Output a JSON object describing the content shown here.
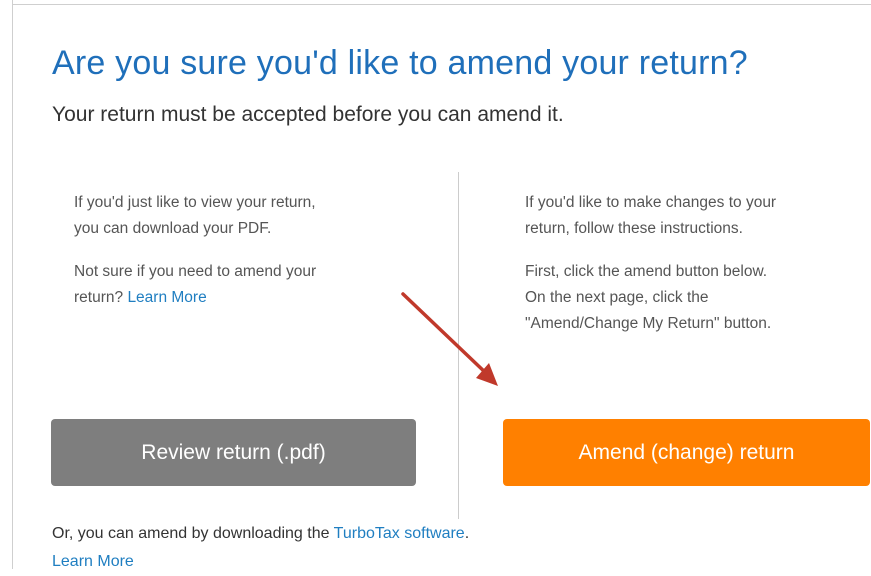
{
  "dialog": {
    "title": "Are you sure you'd like to amend your return?",
    "subtitle": "Your return must be accepted before you can amend it."
  },
  "left_column": {
    "para1_line1": "If you'd just like to view your return,",
    "para1_line2": "you can download your PDF.",
    "para2_line1": "Not sure if you need to amend your",
    "para2_line2_prefix": "return?",
    "learn_more_link": "Learn More"
  },
  "right_column": {
    "para1_line1": "If you'd like to make changes to your",
    "para1_line2": "return, follow these instructions.",
    "para2_line1": "First, click the amend button below.",
    "para2_line2": "On the next page, click the",
    "para2_line3": "\"Amend/Change My Return\" button."
  },
  "buttons": {
    "review_label": "Review return (.pdf)",
    "amend_label": "Amend (change) return"
  },
  "footer": {
    "text_prefix": "Or, you can amend by downloading the",
    "software_link": "TurboTax software",
    "text_suffix": ".",
    "learn_more_link": "Learn More"
  },
  "colors": {
    "title": "#1f6fba",
    "link": "#1f7ec1",
    "review_button": "#7e7e7e",
    "amend_button": "#ff8000",
    "annotation_arrow": "#c0392b"
  }
}
